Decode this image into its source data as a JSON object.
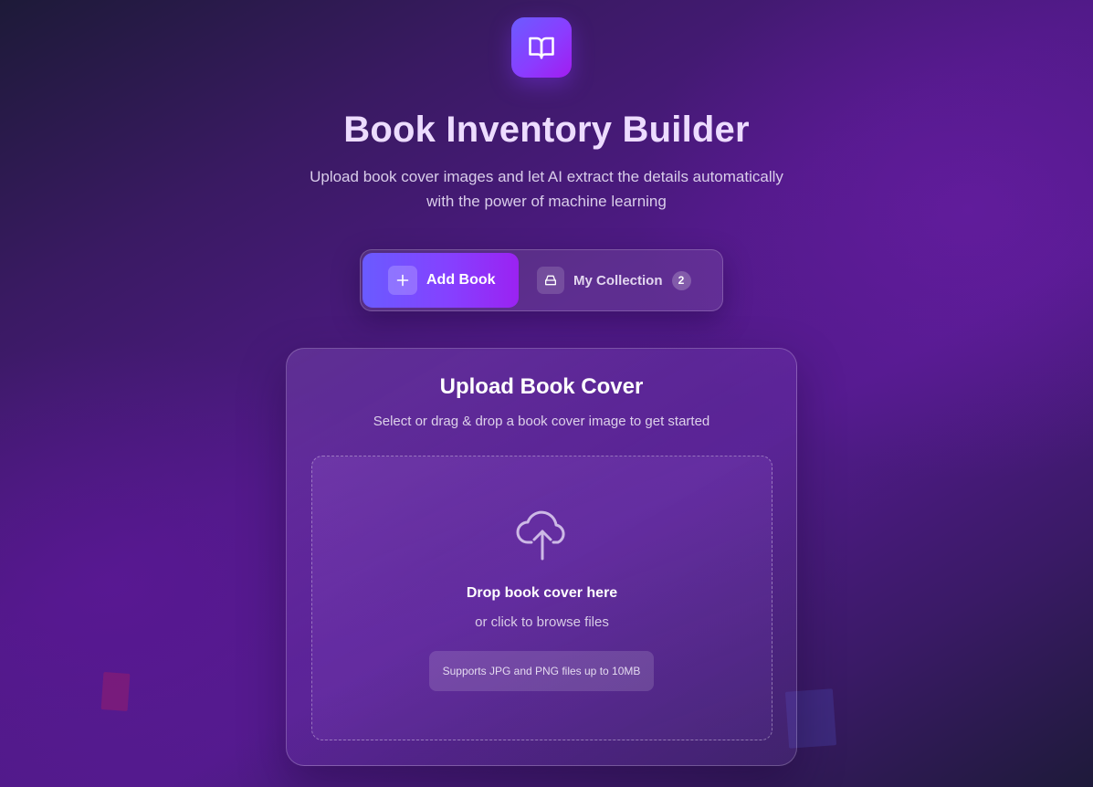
{
  "app": {
    "logo_icon": "open-book-icon",
    "title": "Book Inventory Builder",
    "subtitle_line1": "Upload book cover images and let AI extract the details automatically",
    "subtitle_line2": "with the power of machine learning"
  },
  "tabs": {
    "active": "add-book",
    "add_book": {
      "label": "Add Book",
      "icon": "plus-icon"
    },
    "my_collection": {
      "label": "My Collection",
      "icon": "inbox-icon",
      "count": "2"
    }
  },
  "upload_card": {
    "title": "Upload Book Cover",
    "subtitle": "Select or drag & drop a book cover image to get started",
    "dropzone": {
      "icon": "cloud-upload-icon",
      "title": "Drop book cover here",
      "subtitle": "or click to browse files",
      "supports": "Supports JPG and PNG files up to 10MB"
    }
  },
  "colors": {
    "accent_start": "#6a5bff",
    "accent_end": "#9b22f2",
    "title_text": "#eddcff"
  }
}
